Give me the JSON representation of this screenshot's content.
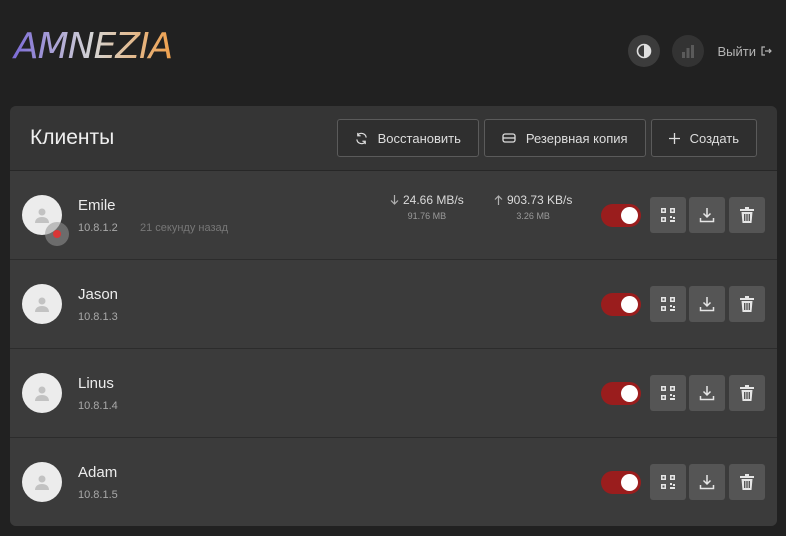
{
  "app": {
    "logo_text": "AMNEZIA"
  },
  "topbar": {
    "logout_label": "Выйти"
  },
  "icons": {
    "theme": "contrast-icon",
    "stats": "bar-chart-icon",
    "logout": "logout-icon",
    "restore": "refresh-icon",
    "backup": "archive-icon",
    "create": "plus-icon",
    "qr": "qr-code-icon",
    "download": "download-icon",
    "delete": "trash-icon",
    "avatar": "user-icon"
  },
  "colors": {
    "accent_toggle": "#9a1d1d",
    "background": "#212121",
    "panel": "#2d2d2d",
    "online_dot": "#d93636"
  },
  "panel": {
    "title": "Клиенты",
    "buttons": {
      "restore": "Восстановить",
      "backup": "Резервная копия",
      "create": "Создать"
    }
  },
  "clients": [
    {
      "name": "Emile",
      "ip": "10.8.1.2",
      "last_seen": "21 секунду назад",
      "online": true,
      "download_rate": "24.66 MB/s",
      "download_total": "91.76 MB",
      "upload_rate": "903.73 KB/s",
      "upload_total": "3.26 MB",
      "enabled": true
    },
    {
      "name": "Jason",
      "ip": "10.8.1.3",
      "enabled": true
    },
    {
      "name": "Linus",
      "ip": "10.8.1.4",
      "enabled": true
    },
    {
      "name": "Adam",
      "ip": "10.8.1.5",
      "enabled": true
    }
  ]
}
